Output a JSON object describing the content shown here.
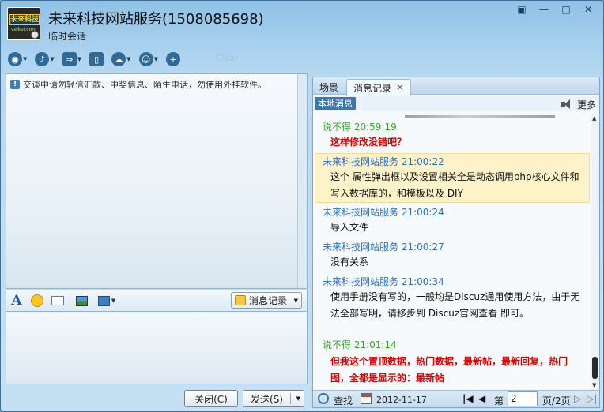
{
  "window": {
    "title": "未来科技网站服务(1508085698)",
    "subtitle": "临时会话",
    "avatar_text": "未来科技",
    "avatar_sub": "veikei.com",
    "buttons": [
      "▣",
      "—",
      "□",
      "✕"
    ]
  },
  "toolbar": {
    "ghost_text": "Clear"
  },
  "left": {
    "notice": "交谈中请勿轻信汇款、中奖信息、陌生电话，勿使用外挂软件。",
    "history_button": "消息记录"
  },
  "buttons": {
    "close": "关闭(C)",
    "send": "发送(S)"
  },
  "right": {
    "tabs": [
      "场景",
      "消息记录"
    ],
    "local_messages": "本地消息",
    "more": "更多",
    "messages": [
      {
        "sender": "说不得",
        "time": "20:59:19",
        "self": true,
        "text": "这样修改没错吧？",
        "red": true
      },
      {
        "sender": "未来科技网站服务",
        "time": "21:00:22",
        "self": false,
        "text": "这个 属性弹出框以及设置相关全是动态调用php核心文件和写入数据库的，和模板以及 DIY",
        "red": false
      },
      {
        "sender": "未来科技网站服务",
        "time": "21:00:24",
        "self": false,
        "text": "导入文件",
        "red": false
      },
      {
        "sender": "未来科技网站服务",
        "time": "21:00:27",
        "self": false,
        "text": "没有关系",
        "red": false
      },
      {
        "sender": "未来科技网站服务",
        "time": "21:00:34",
        "self": false,
        "text": "使用手册没有写的，一般均是Discuz通用使用方法，由于无法全部写明，请移步到 Discuz官网查看 即可。",
        "red": false
      },
      {
        "sender": "说不得",
        "time": "21:01:14",
        "self": true,
        "text": "但我这个置顶数据，热门数据，最新帖，最新回复，热门图，全都是显示的：最新帖",
        "red": true
      }
    ],
    "footer": {
      "find": "查找",
      "date": "2012-11-17",
      "page_prefix": "第",
      "page_value": "2",
      "page_total": "页/2页"
    }
  }
}
